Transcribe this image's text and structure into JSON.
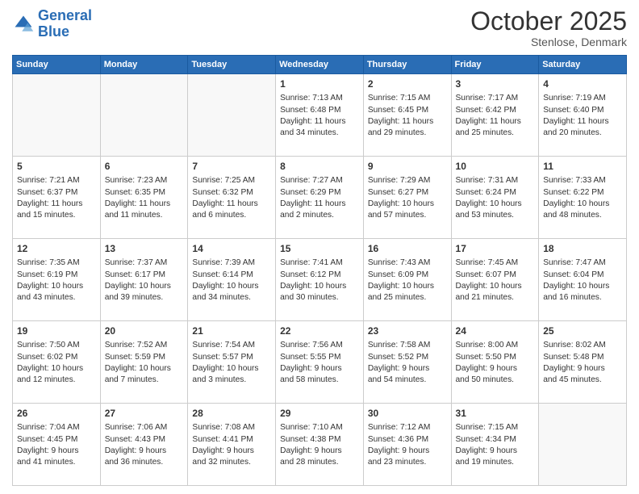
{
  "header": {
    "logo_line1": "General",
    "logo_line2": "Blue",
    "month": "October 2025",
    "location": "Stenlose, Denmark"
  },
  "days_of_week": [
    "Sunday",
    "Monday",
    "Tuesday",
    "Wednesday",
    "Thursday",
    "Friday",
    "Saturday"
  ],
  "weeks": [
    [
      {
        "day": "",
        "info": ""
      },
      {
        "day": "",
        "info": ""
      },
      {
        "day": "",
        "info": ""
      },
      {
        "day": "1",
        "info": "Sunrise: 7:13 AM\nSunset: 6:48 PM\nDaylight: 11 hours\nand 34 minutes."
      },
      {
        "day": "2",
        "info": "Sunrise: 7:15 AM\nSunset: 6:45 PM\nDaylight: 11 hours\nand 29 minutes."
      },
      {
        "day": "3",
        "info": "Sunrise: 7:17 AM\nSunset: 6:42 PM\nDaylight: 11 hours\nand 25 minutes."
      },
      {
        "day": "4",
        "info": "Sunrise: 7:19 AM\nSunset: 6:40 PM\nDaylight: 11 hours\nand 20 minutes."
      }
    ],
    [
      {
        "day": "5",
        "info": "Sunrise: 7:21 AM\nSunset: 6:37 PM\nDaylight: 11 hours\nand 15 minutes."
      },
      {
        "day": "6",
        "info": "Sunrise: 7:23 AM\nSunset: 6:35 PM\nDaylight: 11 hours\nand 11 minutes."
      },
      {
        "day": "7",
        "info": "Sunrise: 7:25 AM\nSunset: 6:32 PM\nDaylight: 11 hours\nand 6 minutes."
      },
      {
        "day": "8",
        "info": "Sunrise: 7:27 AM\nSunset: 6:29 PM\nDaylight: 11 hours\nand 2 minutes."
      },
      {
        "day": "9",
        "info": "Sunrise: 7:29 AM\nSunset: 6:27 PM\nDaylight: 10 hours\nand 57 minutes."
      },
      {
        "day": "10",
        "info": "Sunrise: 7:31 AM\nSunset: 6:24 PM\nDaylight: 10 hours\nand 53 minutes."
      },
      {
        "day": "11",
        "info": "Sunrise: 7:33 AM\nSunset: 6:22 PM\nDaylight: 10 hours\nand 48 minutes."
      }
    ],
    [
      {
        "day": "12",
        "info": "Sunrise: 7:35 AM\nSunset: 6:19 PM\nDaylight: 10 hours\nand 43 minutes."
      },
      {
        "day": "13",
        "info": "Sunrise: 7:37 AM\nSunset: 6:17 PM\nDaylight: 10 hours\nand 39 minutes."
      },
      {
        "day": "14",
        "info": "Sunrise: 7:39 AM\nSunset: 6:14 PM\nDaylight: 10 hours\nand 34 minutes."
      },
      {
        "day": "15",
        "info": "Sunrise: 7:41 AM\nSunset: 6:12 PM\nDaylight: 10 hours\nand 30 minutes."
      },
      {
        "day": "16",
        "info": "Sunrise: 7:43 AM\nSunset: 6:09 PM\nDaylight: 10 hours\nand 25 minutes."
      },
      {
        "day": "17",
        "info": "Sunrise: 7:45 AM\nSunset: 6:07 PM\nDaylight: 10 hours\nand 21 minutes."
      },
      {
        "day": "18",
        "info": "Sunrise: 7:47 AM\nSunset: 6:04 PM\nDaylight: 10 hours\nand 16 minutes."
      }
    ],
    [
      {
        "day": "19",
        "info": "Sunrise: 7:50 AM\nSunset: 6:02 PM\nDaylight: 10 hours\nand 12 minutes."
      },
      {
        "day": "20",
        "info": "Sunrise: 7:52 AM\nSunset: 5:59 PM\nDaylight: 10 hours\nand 7 minutes."
      },
      {
        "day": "21",
        "info": "Sunrise: 7:54 AM\nSunset: 5:57 PM\nDaylight: 10 hours\nand 3 minutes."
      },
      {
        "day": "22",
        "info": "Sunrise: 7:56 AM\nSunset: 5:55 PM\nDaylight: 9 hours\nand 58 minutes."
      },
      {
        "day": "23",
        "info": "Sunrise: 7:58 AM\nSunset: 5:52 PM\nDaylight: 9 hours\nand 54 minutes."
      },
      {
        "day": "24",
        "info": "Sunrise: 8:00 AM\nSunset: 5:50 PM\nDaylight: 9 hours\nand 50 minutes."
      },
      {
        "day": "25",
        "info": "Sunrise: 8:02 AM\nSunset: 5:48 PM\nDaylight: 9 hours\nand 45 minutes."
      }
    ],
    [
      {
        "day": "26",
        "info": "Sunrise: 7:04 AM\nSunset: 4:45 PM\nDaylight: 9 hours\nand 41 minutes."
      },
      {
        "day": "27",
        "info": "Sunrise: 7:06 AM\nSunset: 4:43 PM\nDaylight: 9 hours\nand 36 minutes."
      },
      {
        "day": "28",
        "info": "Sunrise: 7:08 AM\nSunset: 4:41 PM\nDaylight: 9 hours\nand 32 minutes."
      },
      {
        "day": "29",
        "info": "Sunrise: 7:10 AM\nSunset: 4:38 PM\nDaylight: 9 hours\nand 28 minutes."
      },
      {
        "day": "30",
        "info": "Sunrise: 7:12 AM\nSunset: 4:36 PM\nDaylight: 9 hours\nand 23 minutes."
      },
      {
        "day": "31",
        "info": "Sunrise: 7:15 AM\nSunset: 4:34 PM\nDaylight: 9 hours\nand 19 minutes."
      },
      {
        "day": "",
        "info": ""
      }
    ]
  ]
}
